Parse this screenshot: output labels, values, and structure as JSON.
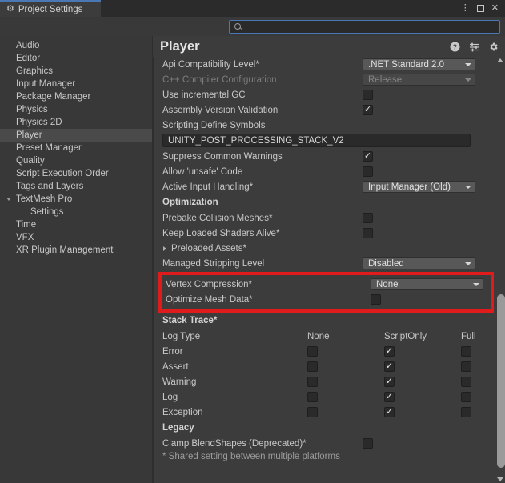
{
  "window": {
    "tab_title": "Project Settings",
    "tab_icon": "gear-icon",
    "controls": {
      "menu": "⋮",
      "maximize": "maximize-icon",
      "close": "✕"
    }
  },
  "search": {
    "value": "",
    "placeholder": "",
    "icon": "search-icon"
  },
  "sidebar": {
    "items": [
      {
        "label": "Audio",
        "selected": false,
        "child": false,
        "arrow": ""
      },
      {
        "label": "Editor",
        "selected": false,
        "child": false,
        "arrow": ""
      },
      {
        "label": "Graphics",
        "selected": false,
        "child": false,
        "arrow": ""
      },
      {
        "label": "Input Manager",
        "selected": false,
        "child": false,
        "arrow": ""
      },
      {
        "label": "Package Manager",
        "selected": false,
        "child": false,
        "arrow": ""
      },
      {
        "label": "Physics",
        "selected": false,
        "child": false,
        "arrow": ""
      },
      {
        "label": "Physics 2D",
        "selected": false,
        "child": false,
        "arrow": ""
      },
      {
        "label": "Player",
        "selected": true,
        "child": false,
        "arrow": ""
      },
      {
        "label": "Preset Manager",
        "selected": false,
        "child": false,
        "arrow": ""
      },
      {
        "label": "Quality",
        "selected": false,
        "child": false,
        "arrow": ""
      },
      {
        "label": "Script Execution Order",
        "selected": false,
        "child": false,
        "arrow": ""
      },
      {
        "label": "Tags and Layers",
        "selected": false,
        "child": false,
        "arrow": ""
      },
      {
        "label": "TextMesh Pro",
        "selected": false,
        "child": false,
        "arrow": "open"
      },
      {
        "label": "Settings",
        "selected": false,
        "child": true,
        "arrow": ""
      },
      {
        "label": "Time",
        "selected": false,
        "child": false,
        "arrow": ""
      },
      {
        "label": "VFX",
        "selected": false,
        "child": false,
        "arrow": ""
      },
      {
        "label": "XR Plugin Management",
        "selected": false,
        "child": false,
        "arrow": ""
      }
    ]
  },
  "panel": {
    "title": "Player",
    "header_icons": [
      "help-icon",
      "preset-icon",
      "settings-gear-icon"
    ]
  },
  "settings": {
    "api_compatibility": {
      "label": "Api Compatibility Level*",
      "value": ".NET Standard 2.0"
    },
    "cpp_compiler": {
      "label": "C++ Compiler Configuration",
      "value": "Release"
    },
    "incremental_gc": {
      "label": "Use incremental GC",
      "checked": false
    },
    "assembly_validation": {
      "label": "Assembly Version Validation",
      "checked": true
    },
    "scripting_define": {
      "label": "Scripting Define Symbols",
      "value": "UNITY_POST_PROCESSING_STACK_V2"
    },
    "suppress_warnings": {
      "label": "Suppress Common Warnings",
      "checked": true
    },
    "unsafe_code": {
      "label": "Allow 'unsafe' Code",
      "checked": false
    },
    "active_input": {
      "label": "Active Input Handling*",
      "value": "Input Manager (Old)"
    }
  },
  "optimization": {
    "header": "Optimization",
    "prebake_collision": {
      "label": "Prebake Collision Meshes*",
      "checked": false
    },
    "keep_shaders": {
      "label": "Keep Loaded Shaders Alive*",
      "checked": false
    },
    "preloaded_assets": {
      "label": "Preloaded Assets*",
      "expanded": false
    },
    "managed_stripping": {
      "label": "Managed Stripping Level",
      "value": "Disabled"
    }
  },
  "highlighted": {
    "border_color": "#e01b1b",
    "vertex_compression": {
      "label": "Vertex Compression*",
      "value": "None"
    },
    "optimize_mesh": {
      "label": "Optimize Mesh Data*",
      "checked": false
    }
  },
  "stack_trace": {
    "header": "Stack Trace*",
    "columns": [
      "Log Type",
      "None",
      "ScriptOnly",
      "Full"
    ],
    "rows": [
      {
        "label": "Error",
        "none": false,
        "scriptonly": true,
        "full": false
      },
      {
        "label": "Assert",
        "none": false,
        "scriptonly": true,
        "full": false
      },
      {
        "label": "Warning",
        "none": false,
        "scriptonly": true,
        "full": false
      },
      {
        "label": "Log",
        "none": false,
        "scriptonly": true,
        "full": false
      },
      {
        "label": "Exception",
        "none": false,
        "scriptonly": true,
        "full": false
      }
    ]
  },
  "legacy": {
    "header": "Legacy",
    "clamp_blendshapes": {
      "label": "Clamp BlendShapes (Deprecated)*",
      "checked": false
    }
  },
  "footnote": "* Shared setting between multiple platforms"
}
